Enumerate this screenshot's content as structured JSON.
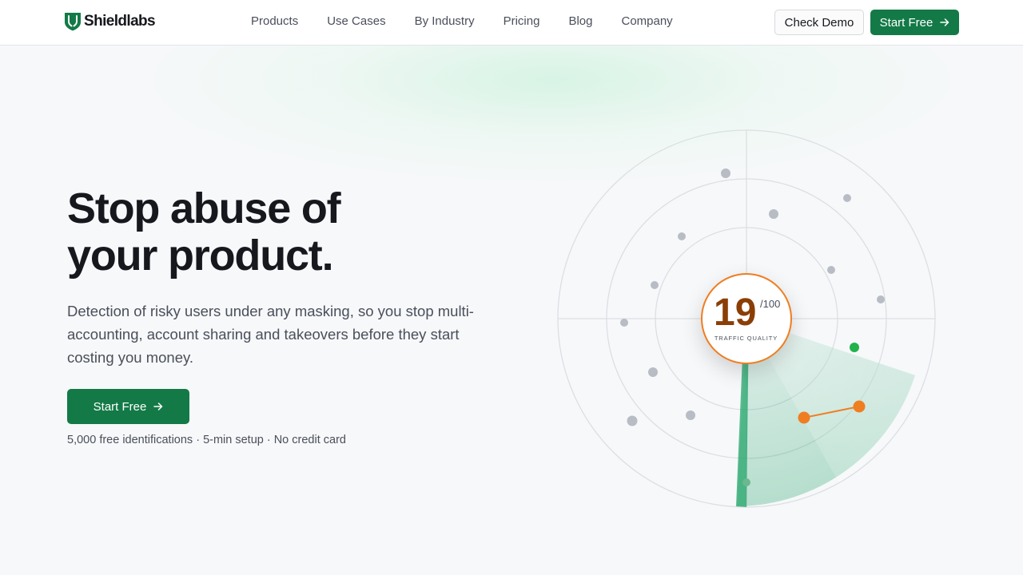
{
  "brand": {
    "name": "Shieldlabs"
  },
  "nav": {
    "items": [
      "Products",
      "Use Cases",
      "By Industry",
      "Pricing",
      "Blog",
      "Company"
    ]
  },
  "header": {
    "demo_label": "Check Demo",
    "start_label": "Start Free"
  },
  "hero": {
    "title_line1": "Stop abuse of",
    "title_line2": "your product.",
    "subtitle": "Detection of risky users under any masking, so you stop multi-accounting, account sharing and takeovers before they start costing you money.",
    "cta_label": "Start Free",
    "note": "5,000 free identifications · 5-min setup · No credit card"
  },
  "radar": {
    "score": "19",
    "score_max": "/100",
    "score_label": "TRAFFIC QUALITY"
  },
  "colors": {
    "brand_green": "#137a47",
    "score_orange": "#ef7e21",
    "score_text": "#8a3e06",
    "safe_dot": "#22b24c"
  }
}
